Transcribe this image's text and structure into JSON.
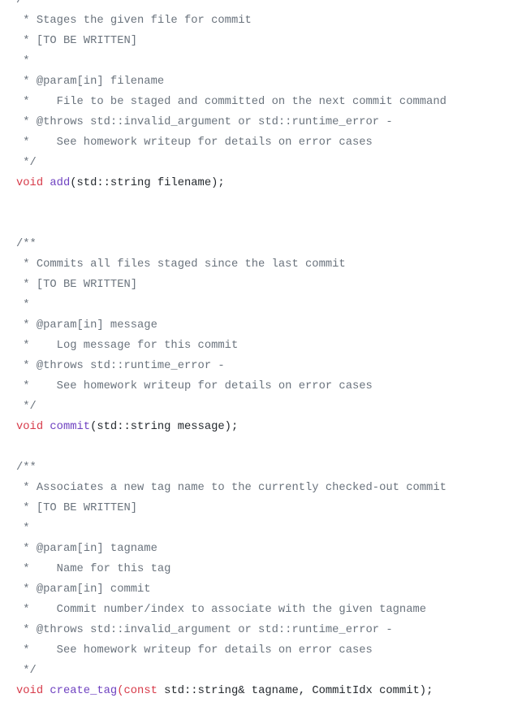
{
  "document": {
    "blocks": [
      {
        "comment_lines": [
          "/**",
          " * Stages the given file for commit",
          " * [TO BE WRITTEN]",
          " *",
          " * @param[in] filename",
          " *    File to be staged and committed on the next commit command",
          " * @throws std::invalid_argument or std::runtime_error -",
          " *    See homework writeup for details on error cases",
          " */"
        ],
        "signature": {
          "prefix_keyword": "void",
          "name": "add",
          "open": "(",
          "params_keyword": "",
          "params": "std::string filename);"
        }
      },
      {
        "comment_lines": [
          "/**",
          " * Commits all files staged since the last commit",
          " * [TO BE WRITTEN]",
          " *",
          " * @param[in] message",
          " *    Log message for this commit",
          " * @throws std::runtime_error -",
          " *    See homework writeup for details on error cases",
          " */"
        ],
        "signature": {
          "prefix_keyword": "void",
          "name": "commit",
          "open": "(",
          "params_keyword": "",
          "params": "std::string message);"
        }
      },
      {
        "comment_lines": [
          "/**",
          " * Associates a new tag name to the currently checked-out commit",
          " * [TO BE WRITTEN]",
          " *",
          " * @param[in] tagname",
          " *    Name for this tag",
          " * @param[in] commit",
          " *    Commit number/index to associate with the given tagname",
          " * @throws std::invalid_argument or std::runtime_error -",
          " *    See homework writeup for details on error cases",
          " */"
        ],
        "signature": {
          "prefix_keyword": "void",
          "name": "create_tag",
          "open": "(",
          "params_keyword": "const",
          "params": " std::string& tagname, CommitIdx commit);"
        }
      }
    ]
  },
  "colors": {
    "comment": "#6a737d",
    "keyword": "#d73a49",
    "function": "#6f42c1",
    "text": "#24292e",
    "background": "#ffffff"
  }
}
